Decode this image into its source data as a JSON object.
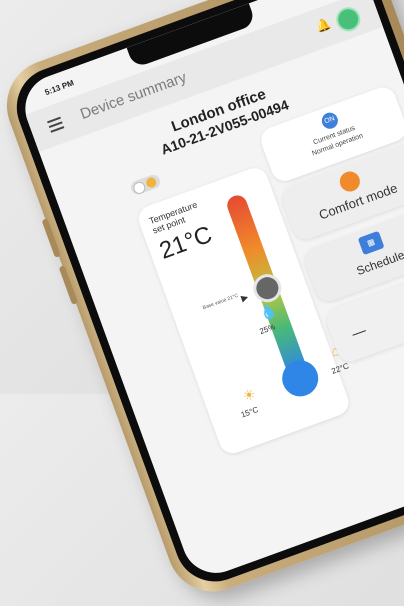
{
  "statusbar": {
    "time": "5:13 PM",
    "icons": "✱ ▲ ▮"
  },
  "topbar": {
    "title": "Device summary"
  },
  "device": {
    "name": "London office",
    "id": "A10-21-2V055-00494"
  },
  "status_card": {
    "icon_text": "ON",
    "label": "Current status",
    "value": "Normal operation"
  },
  "temperature": {
    "label": "Temperature set point",
    "value": "21°C",
    "base_label": "Base value 21°C",
    "pointer": "▶"
  },
  "humidity": {
    "value": "25%"
  },
  "outdoor": {
    "value": "15°C"
  },
  "indoor": {
    "value": "22°C"
  },
  "mode": {
    "label": "Comfort mode",
    "chevron": "›"
  },
  "schedule": {
    "label": "Schedule",
    "icon_text": "▦"
  },
  "fan": {
    "dash": "—"
  },
  "colors": {
    "accent": "#3f7fdc",
    "comfort": "#f08a2a",
    "online": "#49c07a"
  }
}
